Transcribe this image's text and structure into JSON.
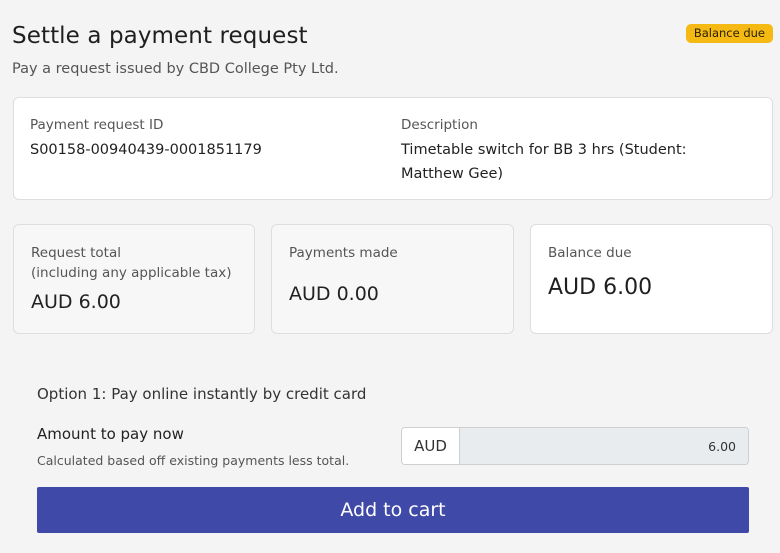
{
  "header": {
    "title": "Settle a payment request",
    "subtitle": "Pay a request issued by CBD College Pty Ltd.",
    "status_badge": "Balance due"
  },
  "request": {
    "id_label": "Payment request ID",
    "id_value": "S00158-00940439-0001851179",
    "description_label": "Description",
    "description_value": "Timetable switch for BB 3 hrs (Student: Matthew Gee)"
  },
  "summary": {
    "total_label": "Request total",
    "total_sublabel": "(including any applicable tax)",
    "total_value": "AUD 6.00",
    "payments_label": "Payments made",
    "payments_value": "AUD 0.00",
    "balance_label": "Balance due",
    "balance_value": "AUD 6.00"
  },
  "payment": {
    "option_title": "Option 1: Pay online instantly by credit card",
    "amount_label": "Amount to pay now",
    "amount_help": "Calculated based off existing payments less total.",
    "currency": "AUD",
    "amount_value": "6.00",
    "add_to_cart_label": "Add to cart"
  },
  "colors": {
    "badge": "#f5b914",
    "primary_button": "#3f49a8",
    "background": "#f4f4f4"
  }
}
